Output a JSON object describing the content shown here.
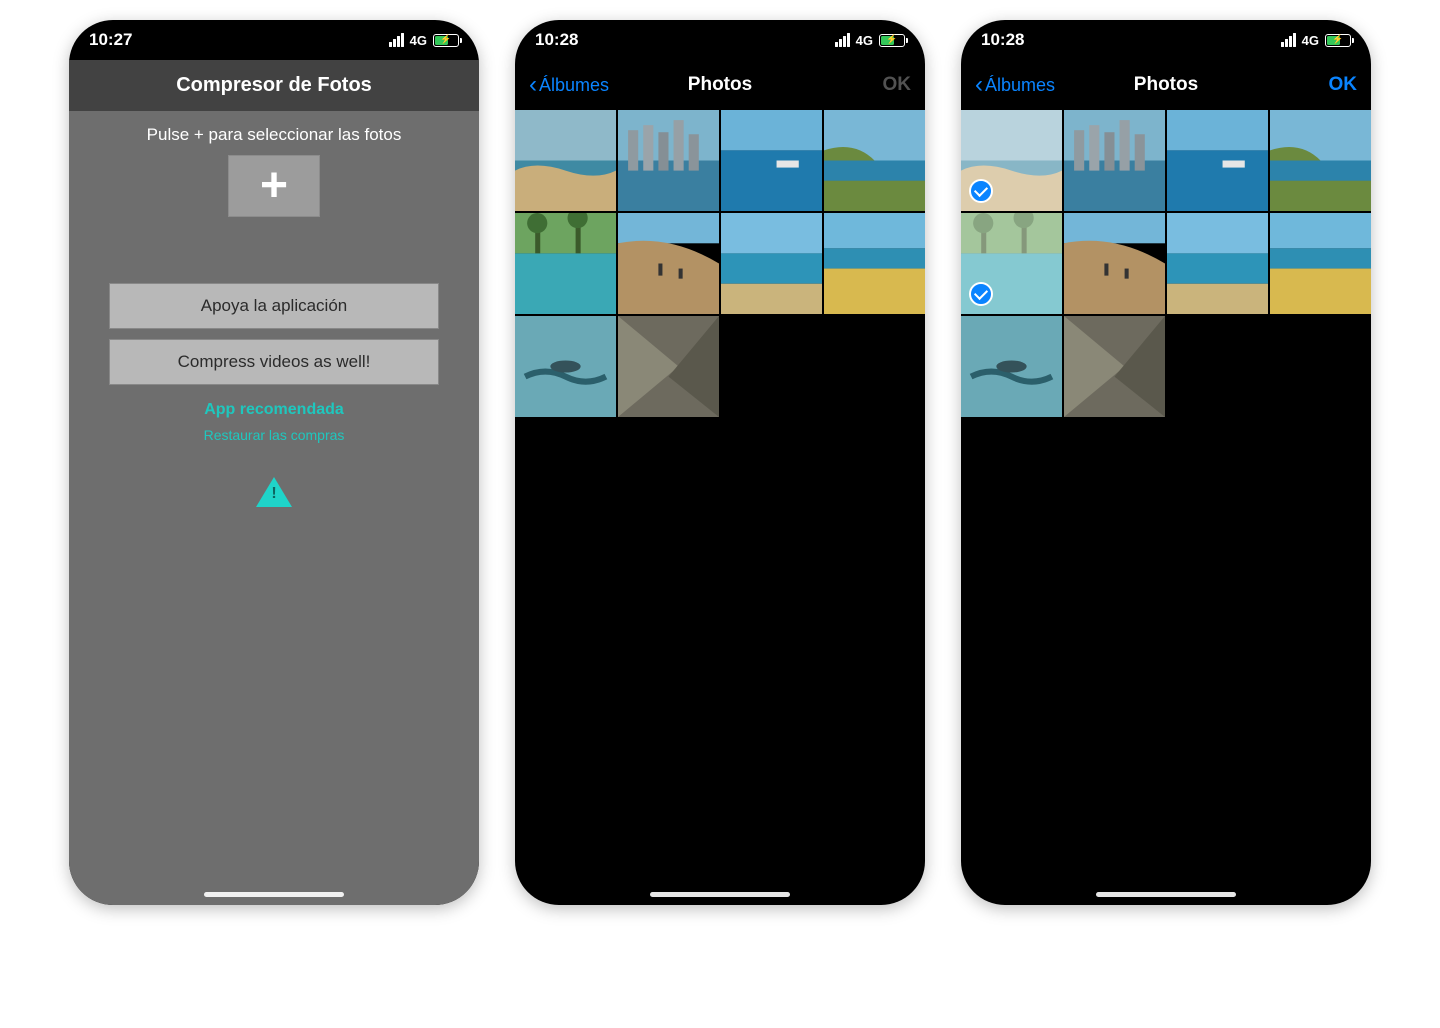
{
  "status": {
    "network": "4G"
  },
  "screen1": {
    "time": "10:27",
    "title": "Compresor de Fotos",
    "subtitle": "Pulse + para seleccionar las fotos",
    "btn_support": "Apoya la aplicación",
    "btn_videos": "Compress videos as well!",
    "link_recommended": "App recomendada",
    "link_restore": "Restaurar las compras"
  },
  "screen2": {
    "time": "10:28",
    "back_label": "Álbumes",
    "title": "Photos",
    "ok_label": "OK",
    "ok_enabled": false,
    "selected": []
  },
  "screen3": {
    "time": "10:28",
    "back_label": "Álbumes",
    "title": "Photos",
    "ok_label": "OK",
    "ok_enabled": true,
    "selected": [
      0,
      4
    ]
  },
  "thumbs": [
    {
      "id": 0,
      "kind": "beach-bay"
    },
    {
      "id": 1,
      "kind": "city-coast"
    },
    {
      "id": 2,
      "kind": "boat-sea"
    },
    {
      "id": 3,
      "kind": "hill-beach"
    },
    {
      "id": 4,
      "kind": "pool-palms"
    },
    {
      "id": 5,
      "kind": "dune-people"
    },
    {
      "id": 6,
      "kind": "lagoon"
    },
    {
      "id": 7,
      "kind": "yellow-beach"
    },
    {
      "id": 8,
      "kind": "snorkel"
    },
    {
      "id": 9,
      "kind": "rock-close"
    }
  ]
}
